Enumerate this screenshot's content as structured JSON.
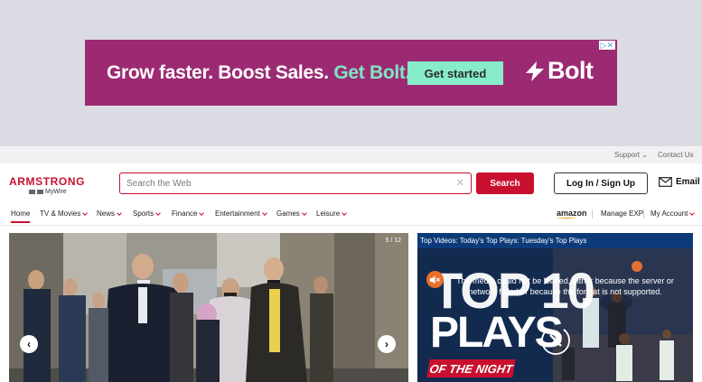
{
  "ad": {
    "headline_part1": "Grow faster. Boost Sales.",
    "headline_part2": "Get Bolt.",
    "cta": "Get started",
    "brand": "Bolt",
    "adchoice": "▷✕"
  },
  "topbar": {
    "support": "Support ⌄",
    "contact": "Contact Us"
  },
  "header": {
    "logo_brand": "ARMSTRONG",
    "logo_sub": "MyWire",
    "search_placeholder": "Search the Web",
    "search_button": "Search",
    "login_button": "Log In / Sign Up",
    "email_label": "Email"
  },
  "nav": {
    "items": [
      {
        "label": "Home"
      },
      {
        "label": "TV & Movies"
      },
      {
        "label": "News"
      },
      {
        "label": "Sports"
      },
      {
        "label": "Finance"
      },
      {
        "label": "Entertainment"
      },
      {
        "label": "Games"
      },
      {
        "label": "Leisure"
      }
    ],
    "amazon": "amazon",
    "manage_exp": "Manage EXP",
    "my_account": "My Account"
  },
  "hero": {
    "counter": "5 / 12",
    "prev": "‹",
    "next": "›"
  },
  "video": {
    "title": "Top Videos: Today's Top Plays: Tuesday's Top Plays",
    "error": "The media could not be loaded, either because the server or network failed or because the format is not supported.",
    "art_top": "TOP 10",
    "art_plays": "PLAYS",
    "art_night": "OF THE NIGHT"
  },
  "colors": {
    "brand_red": "#c8102e",
    "ad_bg": "#9c2a73",
    "ad_accent": "#86ecc9",
    "video_title_bg": "#0d3b7a"
  }
}
